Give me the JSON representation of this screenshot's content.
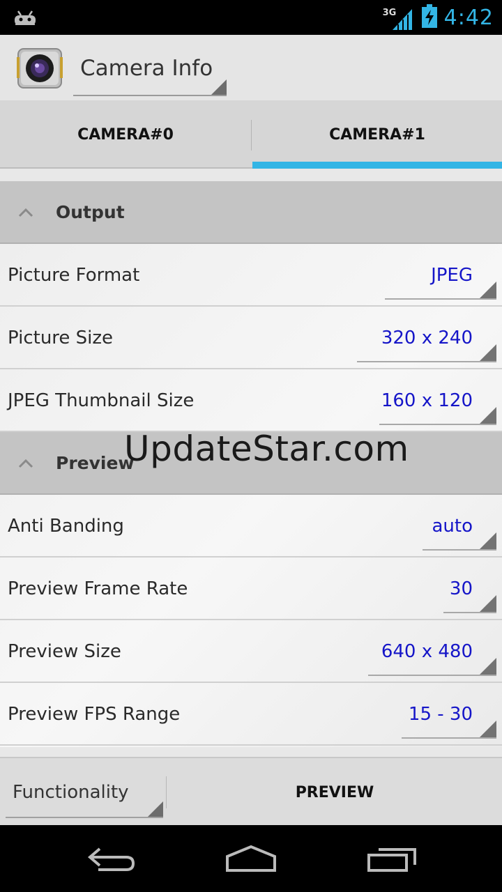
{
  "status_bar": {
    "network": "3G",
    "time": "4:42",
    "left_icon": "android-icon",
    "accent_color": "#33b5e5"
  },
  "action_bar": {
    "title": "Camera Info",
    "icon": "camera-app-icon"
  },
  "tabs": [
    {
      "label": "CAMERA#0",
      "selected": false
    },
    {
      "label": "CAMERA#1",
      "selected": true
    }
  ],
  "sections": [
    {
      "title": "Output",
      "rows": [
        {
          "label": "Picture Format",
          "value": "JPEG"
        },
        {
          "label": "Picture Size",
          "value": "320 x 240"
        },
        {
          "label": "JPEG Thumbnail Size",
          "value": "160 x 120"
        }
      ]
    },
    {
      "title": "Preview",
      "rows": [
        {
          "label": "Anti Banding",
          "value": "auto"
        },
        {
          "label": "Preview Frame Rate",
          "value": "30"
        },
        {
          "label": "Preview Size",
          "value": "640 x 480"
        },
        {
          "label": "Preview FPS Range",
          "value": "15 - 30"
        }
      ]
    }
  ],
  "watermark": "UpdateStar.com",
  "bottom_bar": {
    "functionality_label": "Functionality",
    "preview_label": "PREVIEW"
  },
  "value_color": "#1515c8",
  "nav_icons": [
    "back-icon",
    "home-icon",
    "recents-icon"
  ]
}
